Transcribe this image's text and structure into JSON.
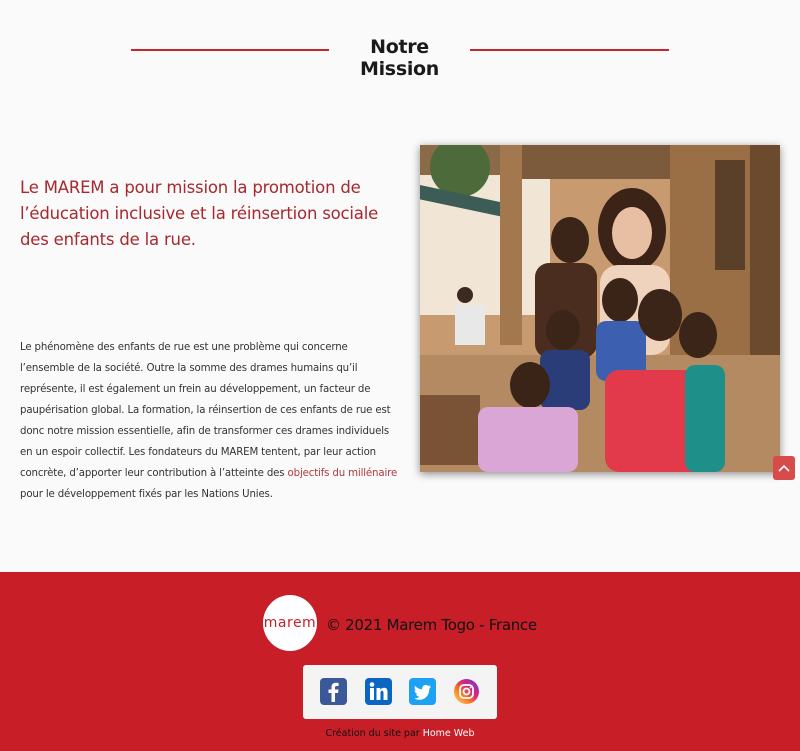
{
  "section": {
    "title": "Notre Mission"
  },
  "mission": {
    "lead_line1": "Le MAREM a pour mission la promotion de",
    "lead_line2": "l’éducation inclusive et la réinsertion sociale",
    "lead_line3": "des enfants de la rue.",
    "body_l1": "Le phénomène des enfants de rue est une problème qui concerne",
    "body_l2": "l’ensemble de la société. Outre la somme des drames humains qu’il",
    "body_l3": "représente, il est également un frein au développement, un facteur de",
    "body_l4": "paupérisation global. La formation, la réinsertion de ces enfants de rue est",
    "body_l5": "donc notre mission essentielle, afin de transformer ces drames individuels",
    "body_l6": "en un espoir collectif. Les fondateurs du MAREM tentent, par leur action",
    "body_l7a": "concrète, d’apporter leur contribution à l’atteinte des ",
    "body_l7_link": "objectifs du millénaire",
    "body_l8": "pour le développement fixés par les Nations Unies."
  },
  "footer": {
    "logo_text": "marem",
    "copyright": "© 2021 Marem Togo - France",
    "credits_prefix": "Création du site par ",
    "credits_link": "Home Web",
    "social": [
      {
        "name": "facebook-icon",
        "color": "#3b5998"
      },
      {
        "name": "linkedin-icon",
        "color": "#0a66c2"
      },
      {
        "name": "twitter-icon",
        "color": "#1da1f2"
      },
      {
        "name": "instagram-icon",
        "color": "#d62976"
      }
    ]
  },
  "colors": {
    "accent": "#c0282f",
    "footer_bg": "#c81e28",
    "lead_text": "#a8282e"
  }
}
